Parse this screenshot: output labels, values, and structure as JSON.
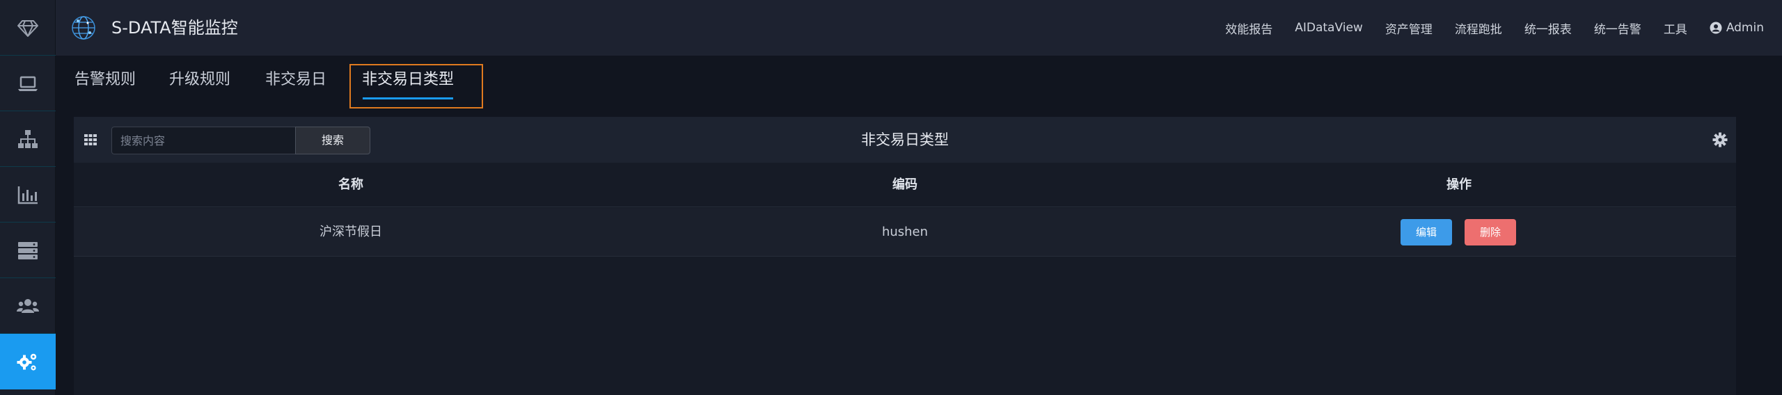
{
  "colors": {
    "accent": "#1a9bf0",
    "highlight_border": "#e07a1f",
    "edit_button": "#3d9be9",
    "delete_button": "#ed6f6f"
  },
  "sidebar": {
    "items": [
      {
        "icon": "diamond-icon"
      },
      {
        "icon": "laptop-icon"
      },
      {
        "icon": "sitemap-icon"
      },
      {
        "icon": "bar-chart-icon"
      },
      {
        "icon": "server-icon"
      },
      {
        "icon": "users-icon"
      },
      {
        "icon": "gears-icon",
        "active": true
      }
    ]
  },
  "header": {
    "logo": "globe-logo-icon",
    "brand": "S-DATA智能监控",
    "nav": [
      "效能报告",
      "AIDataView",
      "资产管理",
      "流程跑批",
      "统一报表",
      "统一告警",
      "工具"
    ],
    "user": "Admin",
    "user_icon": "user-circle-icon"
  },
  "tabs": [
    {
      "label": "告警规则"
    },
    {
      "label": "升级规则"
    },
    {
      "label": "非交易日"
    },
    {
      "label": "非交易日类型",
      "active": true
    }
  ],
  "panel": {
    "title": "非交易日类型",
    "search": {
      "placeholder": "搜索内容",
      "value": "",
      "button": "搜索"
    },
    "columns": [
      "名称",
      "编码",
      "操作"
    ],
    "rows": [
      {
        "name": "沪深节假日",
        "code": "hushen",
        "actions": [
          "编辑",
          "删除"
        ]
      }
    ]
  }
}
